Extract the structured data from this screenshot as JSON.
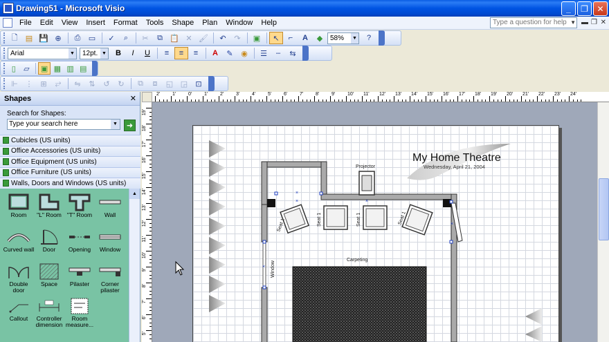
{
  "window": {
    "title": "Drawing51 - Microsoft Visio"
  },
  "menubar": {
    "items": [
      "File",
      "Edit",
      "View",
      "Insert",
      "Format",
      "Tools",
      "Shape",
      "Plan",
      "Window",
      "Help"
    ],
    "help_placeholder": "Type a question for help"
  },
  "toolbar": {
    "zoom": "58%",
    "font": "Arial",
    "font_size": "12pt."
  },
  "shapes_panel": {
    "title": "Shapes",
    "search_label": "Search for Shapes:",
    "search_placeholder": "Type your search here",
    "stencils": [
      "Cubicles (US units)",
      "Office Accessories (US units)",
      "Office Equipment (US units)",
      "Office Furniture (US units)",
      "Walls, Doors and Windows (US units)"
    ],
    "masters": [
      {
        "label": "Room",
        "icon": "room-icon"
      },
      {
        "label": "\"L\" Room",
        "icon": "l-room-icon"
      },
      {
        "label": "\"T\" Room",
        "icon": "t-room-icon"
      },
      {
        "label": "Wall",
        "icon": "wall-icon"
      },
      {
        "label": "Curved wall",
        "icon": "curved-wall-icon"
      },
      {
        "label": "Door",
        "icon": "door-icon"
      },
      {
        "label": "Opening",
        "icon": "opening-icon"
      },
      {
        "label": "Window",
        "icon": "window-icon"
      },
      {
        "label": "Double door",
        "icon": "double-door-icon"
      },
      {
        "label": "Space",
        "icon": "space-icon"
      },
      {
        "label": "Pilaster",
        "icon": "pilaster-icon"
      },
      {
        "label": "Corner pilaster",
        "icon": "corner-pilaster-icon"
      },
      {
        "label": "Callout",
        "icon": "callout-icon"
      },
      {
        "label": "Controller dimension",
        "icon": "controller-dimension-icon"
      },
      {
        "label": "Room measure...",
        "icon": "room-measure-icon"
      }
    ]
  },
  "ruler": {
    "h_labels": [
      "2'",
      "1'",
      "0'",
      "1'",
      "2'",
      "3'",
      "4'",
      "5'",
      "6'",
      "7'",
      "8'",
      "9'",
      "10'",
      "11'",
      "12'",
      "13'",
      "14'",
      "15'",
      "16'",
      "17'",
      "18'",
      "19'",
      "20'",
      "21'",
      "22'",
      "23'",
      "24'"
    ],
    "v_labels": [
      "19'",
      "18'",
      "17'",
      "16'",
      "15'",
      "14'",
      "13'",
      "12'",
      "11'",
      "10'",
      "9'",
      "8'",
      "7'",
      "6'",
      "5'"
    ]
  },
  "drawing": {
    "title": "My Home Theatre",
    "date": "Wednesday, April 21, 2004",
    "projector_label": "Projector",
    "carpeting_label": "Carpeting",
    "window_label": "Window",
    "seats": [
      "Seat 1",
      "Seat 1",
      "Seat 1",
      "Seat 1"
    ]
  }
}
